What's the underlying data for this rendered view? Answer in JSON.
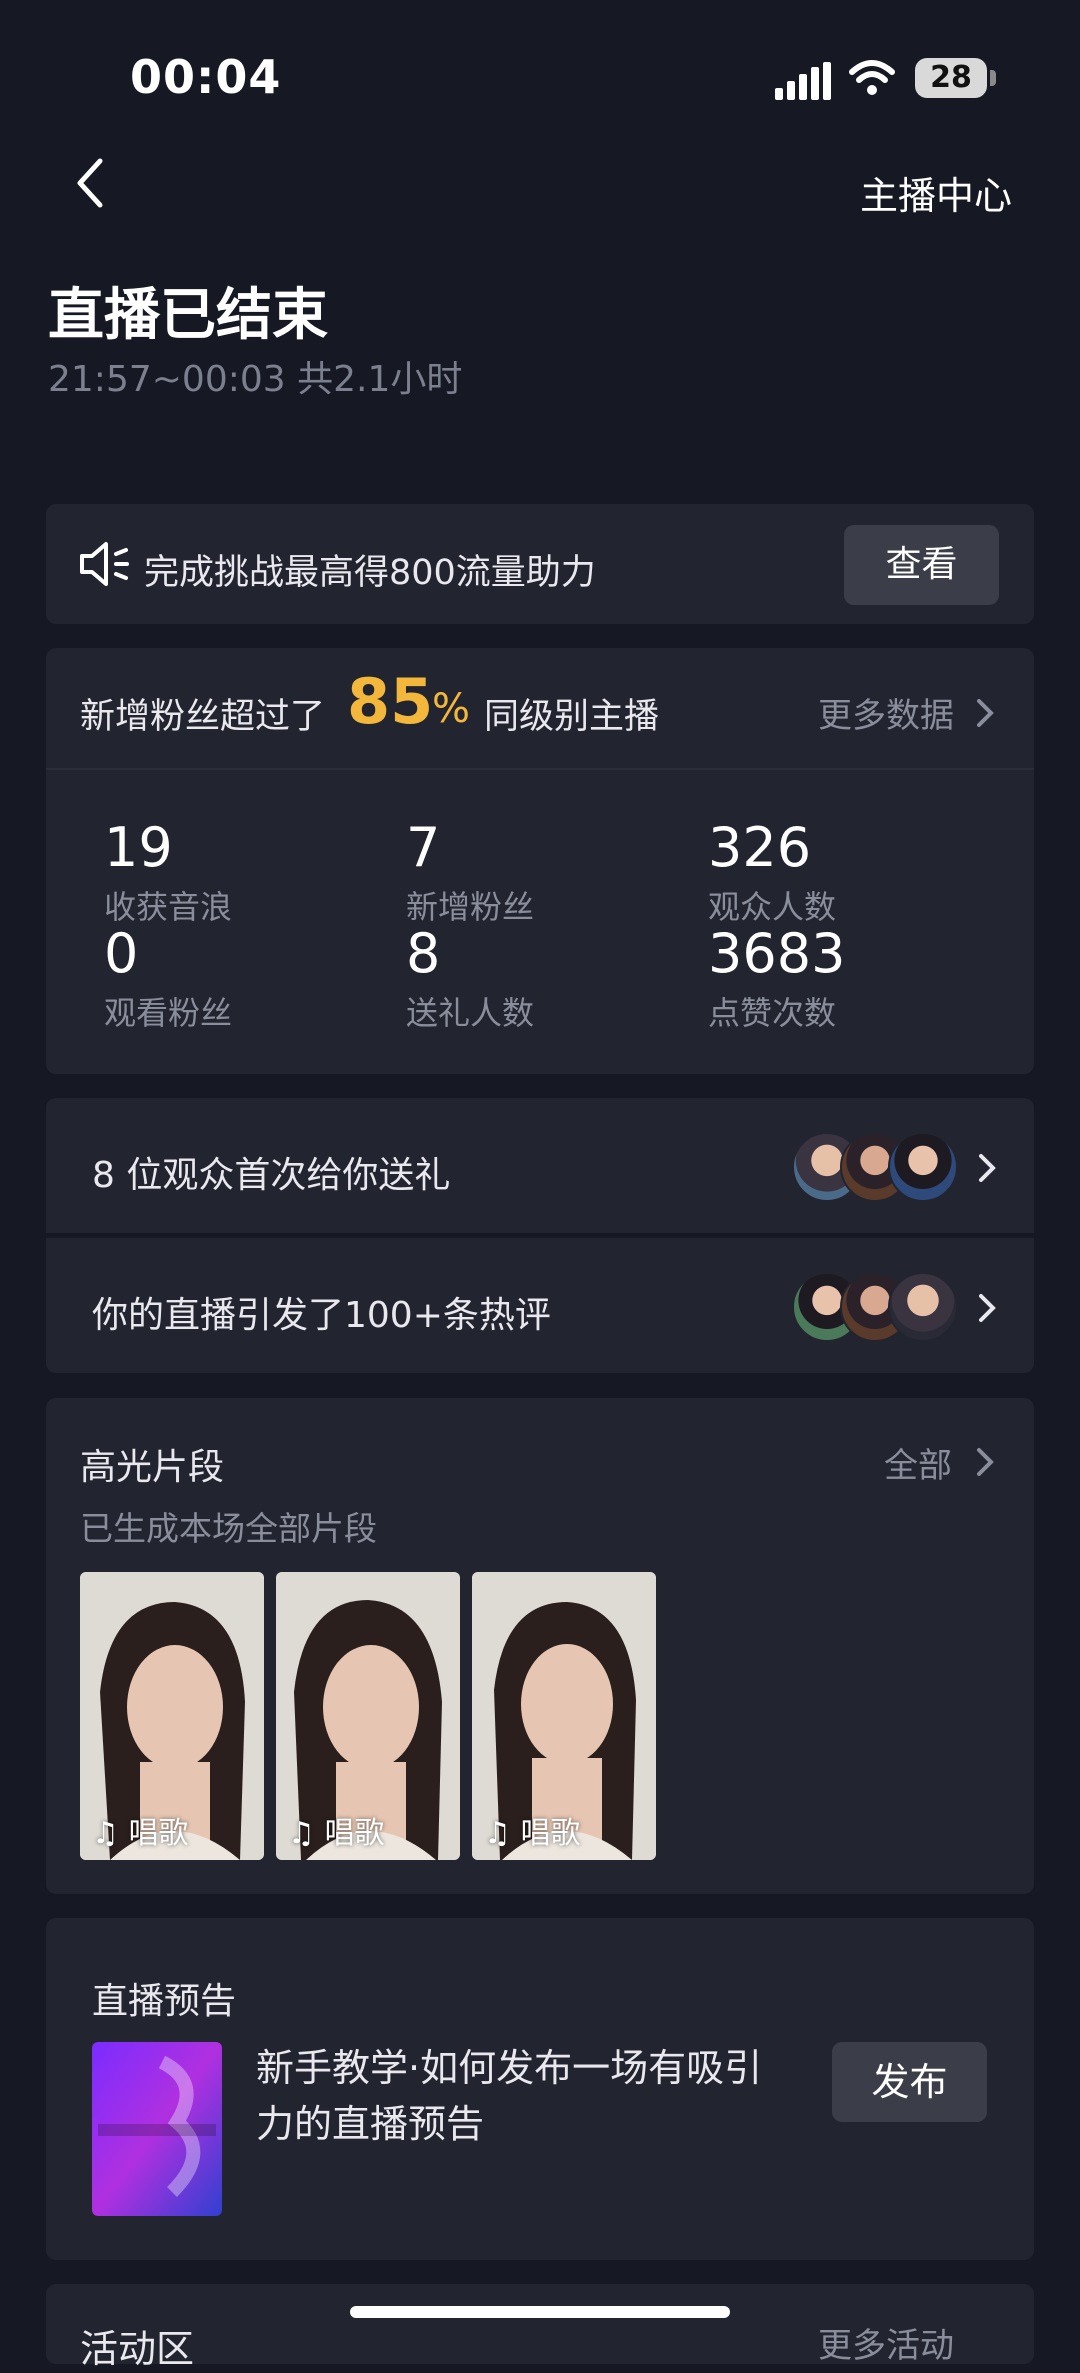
{
  "status_bar": {
    "time": "00:04",
    "battery": "28"
  },
  "nav": {
    "right_link": "主播中心"
  },
  "header": {
    "title": "直播已结束",
    "subtitle": "21:57~00:03 共2.1小时"
  },
  "notice": {
    "text": "完成挑战最高得800流量助力",
    "button": "查看"
  },
  "stats": {
    "head_prefix": "新增粉丝超过了",
    "percent": "85",
    "percent_sign": "%",
    "head_suffix": "同级别主播",
    "more": "更多数据",
    "items": [
      {
        "value": "19",
        "label": "收获音浪"
      },
      {
        "value": "7",
        "label": "新增粉丝"
      },
      {
        "value": "326",
        "label": "观众人数"
      },
      {
        "value": "0",
        "label": "观看粉丝"
      },
      {
        "value": "8",
        "label": "送礼人数"
      },
      {
        "value": "3683",
        "label": "点赞次数"
      }
    ]
  },
  "rows": [
    {
      "text": "8 位观众首次给你送礼"
    },
    {
      "text": "你的直播引发了100+条热评"
    }
  ],
  "highlights": {
    "title": "高光片段",
    "all": "全部",
    "subtitle": "已生成本场全部片段",
    "clips": [
      {
        "label": "唱歌"
      },
      {
        "label": "唱歌"
      },
      {
        "label": "唱歌"
      }
    ]
  },
  "preview": {
    "title": "直播预告",
    "text": "新手教学·如何发布一场有吸引力的直播预告",
    "button": "发布"
  },
  "activity": {
    "title": "活动区",
    "more": "更多活动"
  },
  "colors": {
    "accent": "#f2b73b",
    "background": "#161824",
    "card": "#22242f"
  }
}
